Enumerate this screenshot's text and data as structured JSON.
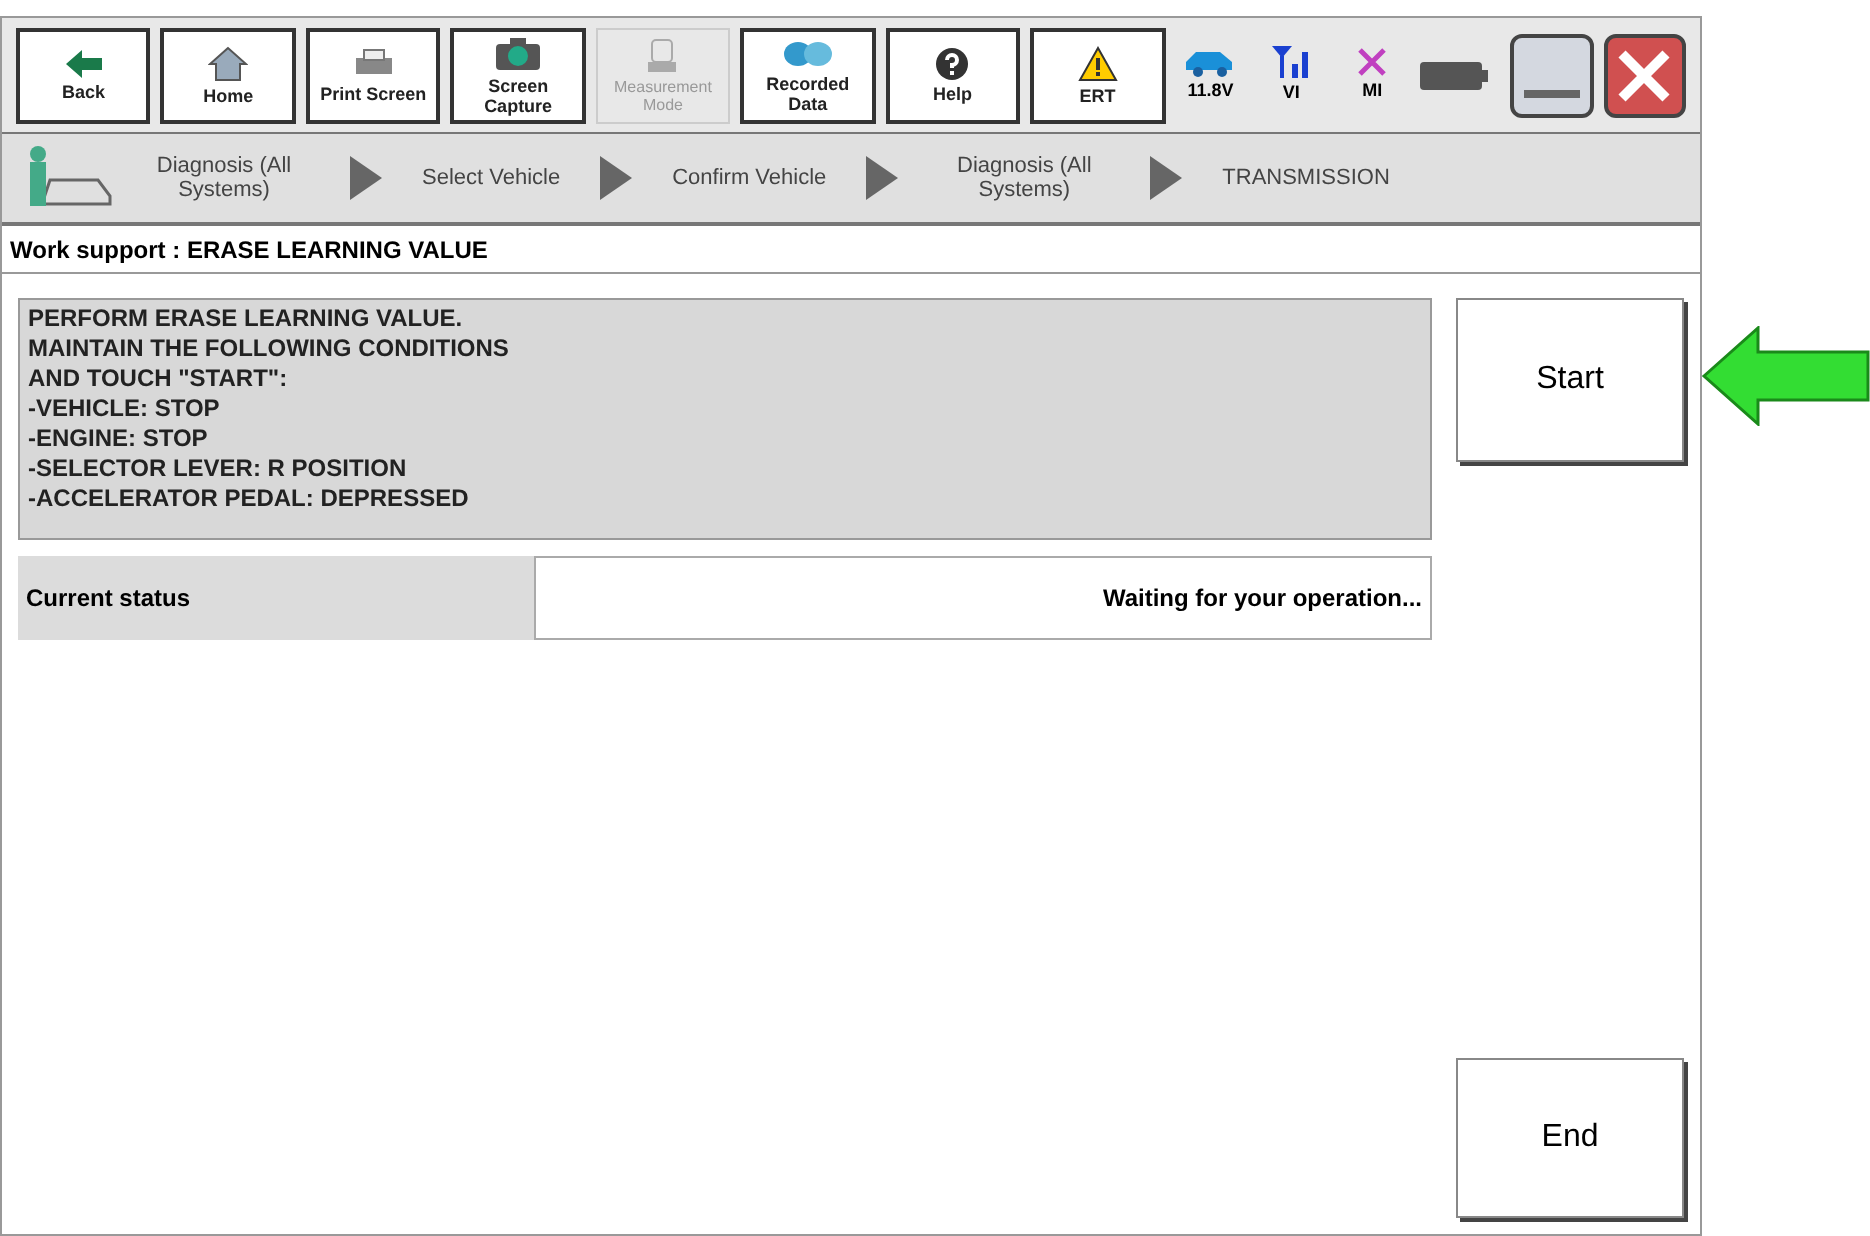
{
  "toolbar": {
    "buttons": [
      {
        "label": "Back",
        "kind": "back",
        "disabled": false
      },
      {
        "label": "Home",
        "kind": "home",
        "disabled": false
      },
      {
        "label": "Print Screen",
        "kind": "print",
        "disabled": false
      },
      {
        "label": "Screen Capture",
        "kind": "camera",
        "disabled": false
      },
      {
        "label": "Measurement Mode",
        "kind": "measure",
        "disabled": true
      },
      {
        "label": "Recorded Data",
        "kind": "data",
        "disabled": false
      },
      {
        "label": "Help",
        "kind": "help",
        "disabled": false
      },
      {
        "label": "ERT",
        "kind": "warning",
        "disabled": false
      }
    ],
    "status": [
      {
        "label": "11.8V",
        "kind": "car"
      },
      {
        "label": "VI",
        "kind": "signal"
      },
      {
        "label": "MI",
        "kind": "cross"
      },
      {
        "kind": "battery"
      }
    ]
  },
  "breadcrumb": [
    "Diagnosis (All Systems)",
    "Select Vehicle",
    "Confirm Vehicle",
    "Diagnosis (All Systems)",
    "TRANSMISSION"
  ],
  "title": "Work support : ERASE LEARNING VALUE",
  "instructions": [
    "PERFORM ERASE LEARNING VALUE.",
    "MAINTAIN THE FOLLOWING CONDITIONS",
    "AND TOUCH \"START\":",
    "-VEHICLE: STOP",
    "-ENGINE: STOP",
    "-SELECTOR LEVER: R POSITION",
    "-ACCELERATOR PEDAL: DEPRESSED"
  ],
  "status_row": {
    "label": "Current status",
    "value": "Waiting for your operation..."
  },
  "buttons": {
    "start": "Start",
    "end": "End"
  }
}
